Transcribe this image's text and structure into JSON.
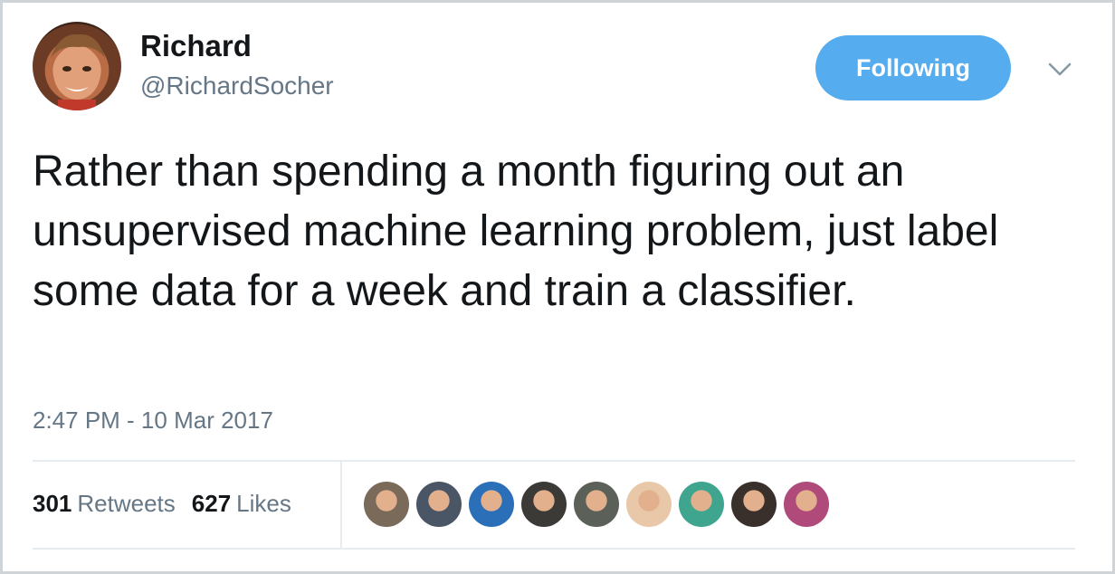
{
  "user": {
    "name": "Richard",
    "handle": "@RichardSocher"
  },
  "follow_button": {
    "label": "Following",
    "color": "#55acee"
  },
  "menu_icon": "chevron-down-icon",
  "tweet": {
    "text": "Rather than spending a month figuring out an unsupervised machine learning problem, just label some data for a week and train a classifier.",
    "timestamp": "2:47 PM - 10 Mar 2017"
  },
  "stats": {
    "retweets_count": "301",
    "retweets_label": "Retweets",
    "likes_count": "627",
    "likes_label": "Likes"
  },
  "likers": [
    {
      "color": "#7a6a5a"
    },
    {
      "color": "#4a5566"
    },
    {
      "color": "#2a6fb8"
    },
    {
      "color": "#3b3a36"
    },
    {
      "color": "#5b6058"
    },
    {
      "color": "#e8c8a8"
    },
    {
      "color": "#3fa58f"
    },
    {
      "color": "#3a302b"
    },
    {
      "color": "#b04a7a"
    }
  ]
}
